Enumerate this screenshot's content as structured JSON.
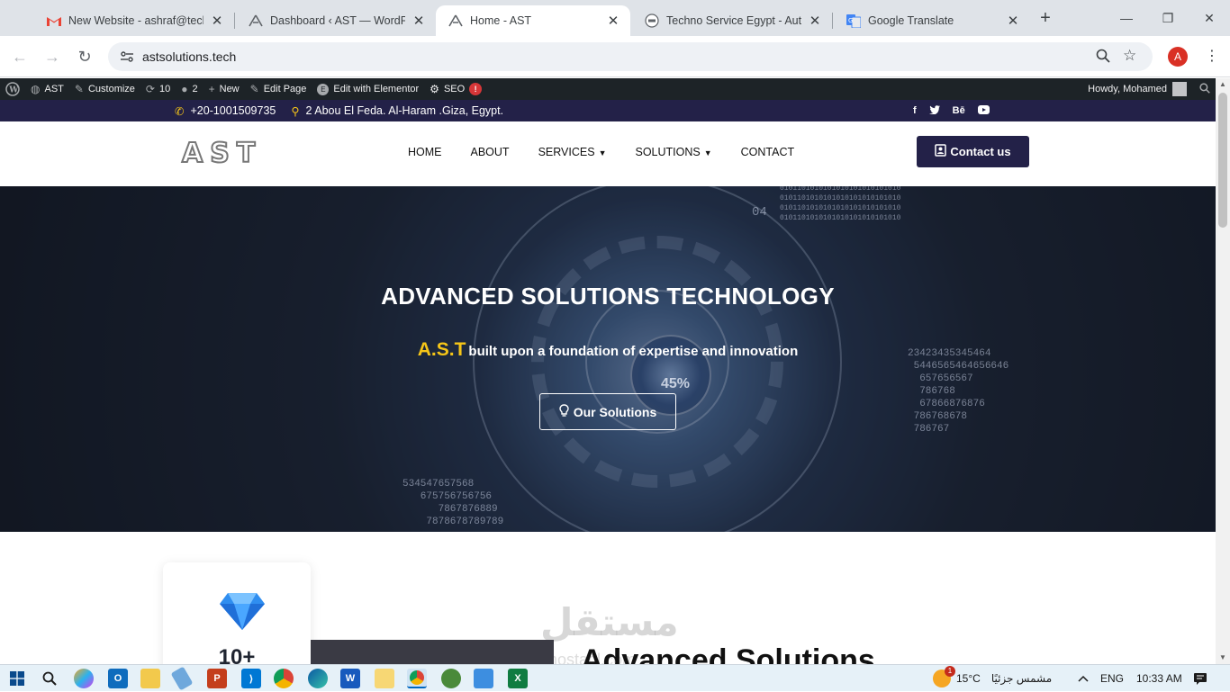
{
  "browser": {
    "tabs": [
      {
        "title": "New Website - ashraf@techno",
        "icon": "gmail-icon",
        "active": false
      },
      {
        "title": "Dashboard ‹ AST — WordPress",
        "icon": "ast-logo-icon",
        "active": false
      },
      {
        "title": "Home - AST",
        "icon": "ast-logo-icon",
        "active": true
      },
      {
        "title": "Techno Service Egypt - Autom",
        "icon": "site-icon",
        "active": false
      },
      {
        "title": "Google Translate",
        "icon": "google-translate-icon",
        "active": false
      }
    ],
    "url": "astsolutions.tech",
    "profile_initial": "A"
  },
  "wp_admin_bar": {
    "site": "AST",
    "customize": "Customize",
    "updates": "10",
    "comments": "2",
    "new": "New",
    "edit_page": "Edit Page",
    "elementor": "Edit with Elementor",
    "seo": "SEO",
    "seo_badge": "!",
    "howdy": "Howdy, Mohamed"
  },
  "topbar": {
    "phone": "+20-1001509735",
    "address": "2 Abou El Feda. Al-Haram .Giza, Egypt.",
    "social": [
      "f",
      "t",
      "Bē",
      "▶"
    ]
  },
  "header": {
    "logo": "AST",
    "nav": [
      {
        "label": "HOME",
        "dropdown": false
      },
      {
        "label": "ABOUT",
        "dropdown": false
      },
      {
        "label": "SERVICES",
        "dropdown": true
      },
      {
        "label": "SOLUTIONS",
        "dropdown": true
      },
      {
        "label": "CONTACT",
        "dropdown": false
      }
    ],
    "cta": "Contact us"
  },
  "hero": {
    "title": "ADVANCED SOLUTIONS TECHNOLOGY",
    "brand": "A.S.T",
    "subtitle": "built upon a foundation of expertise and innovation",
    "button": "Our Solutions",
    "percent": "45%",
    "numbers_right": "23423435345464\n 5446565464656646\n  657656567\n  786768\n  67866876876\n 786768678\n 786767",
    "numbers_left": "534547657568\n   675756756756\n      7867876889\n    7878678789789",
    "binary": "0101101010101010101010101010\n0101101010101010101010101010\n0101101010101010101010101010\n0101101010101010101010101010",
    "side_num": "04"
  },
  "content": {
    "stat_value": "10+",
    "section_title": "Advanced Solutions",
    "watermark": "مستقل",
    "watermark_sub": "mostaql.com"
  },
  "taskbar": {
    "weather": "15°C",
    "weather_text": "مشمس جزئيًا",
    "weather_badge": "1",
    "lang": "ENG",
    "time": "10:33 AM"
  },
  "colors": {
    "brand_navy": "#232148",
    "accent_yellow": "#f5c518",
    "wp_bar": "#1d2327"
  }
}
